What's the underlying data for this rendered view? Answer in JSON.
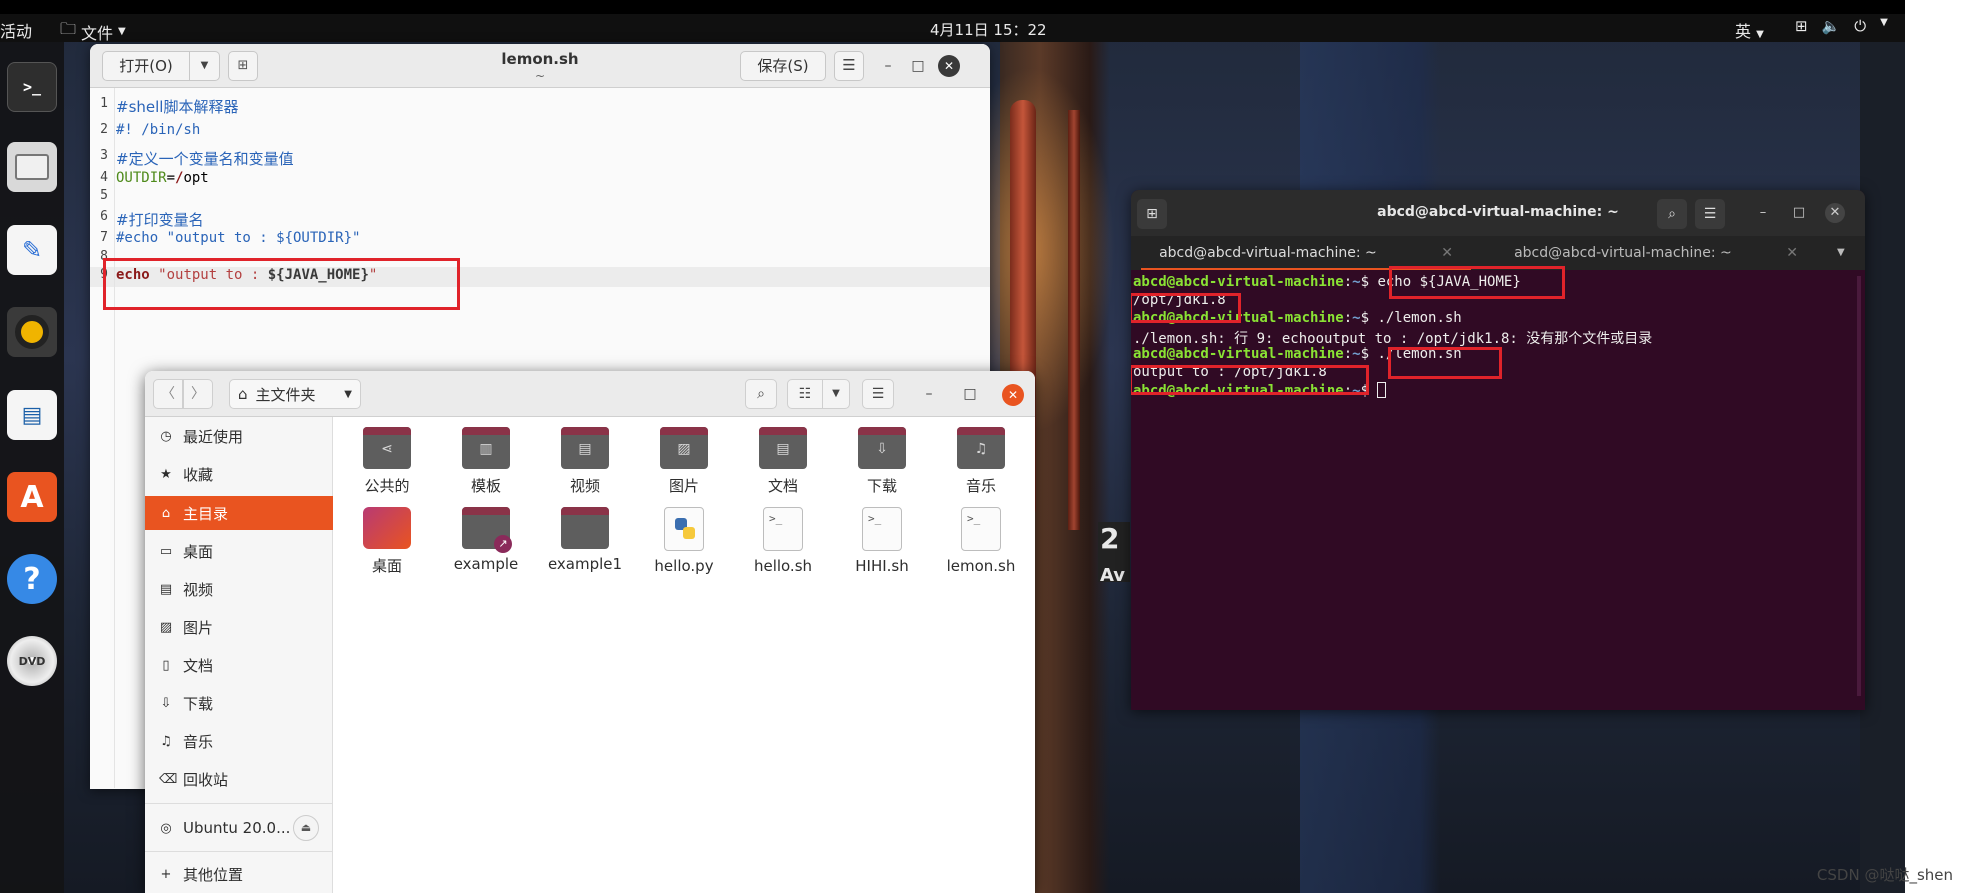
{
  "topbar": {
    "activities": "活动",
    "app_menu": "文件",
    "clock": "4月11日  15：22",
    "lang": "英"
  },
  "dock": {
    "items": [
      {
        "icon": "terminal-icon"
      },
      {
        "icon": "files-icon"
      },
      {
        "icon": "text-editor-icon"
      },
      {
        "icon": "rhythmbox-icon"
      },
      {
        "icon": "libreoffice-writer-icon"
      },
      {
        "icon": "software-center-icon",
        "glyph": "A"
      },
      {
        "icon": "help-icon",
        "glyph": "?"
      },
      {
        "icon": "dvd-icon",
        "glyph": "DVD"
      }
    ]
  },
  "editor": {
    "open_label": "打开(O)",
    "title": "lemon.sh",
    "subtitle": "~",
    "save_label": "保存(S)",
    "lines": [
      {
        "n": "1",
        "text": "#shell脚本解释器"
      },
      {
        "n": "2",
        "text": "#! /bin/sh"
      },
      {
        "n": "3",
        "text": "#定义一个变量名和变量值"
      },
      {
        "n": "4",
        "var": "OUTDIR",
        "op": "=",
        "slash": "/",
        "rest": "opt"
      },
      {
        "n": "5",
        "text": ""
      },
      {
        "n": "6",
        "text": "#打印变量名"
      },
      {
        "n": "7",
        "text": "#echo \"output to : ${OUTDIR}\""
      },
      {
        "n": "8",
        "text": ""
      },
      {
        "n": "9",
        "kw": "echo",
        "str": "\"output to : ",
        "var": "${JAVA_HOME}",
        "end": "\""
      }
    ]
  },
  "terminal": {
    "title": "abcd@abcd-virtual-machine: ~",
    "tabs": [
      "abcd@abcd-virtual-machine: ~",
      "abcd@abcd-virtual-machine: ~"
    ],
    "prompt_user": "abcd@abcd-virtual-machine",
    "prompt_path": "~",
    "lines": [
      {
        "type": "prompt",
        "cmd": "echo ${JAVA_HOME}"
      },
      {
        "type": "out",
        "text": "/opt/jdk1.8"
      },
      {
        "type": "prompt",
        "cmd": "./lemon.sh"
      },
      {
        "type": "out",
        "text": "./lemon.sh: 行 9: echooutput to : /opt/jdk1.8: 没有那个文件或目录"
      },
      {
        "type": "prompt",
        "cmd": "./lemon.sh"
      },
      {
        "type": "out",
        "text": "output to : /opt/jdk1.8"
      },
      {
        "type": "prompt",
        "cmd": ""
      }
    ]
  },
  "files": {
    "path_label": "主文件夹",
    "sidebar": [
      {
        "icon": "recent-icon",
        "label": "最近使用",
        "glyph": "◷"
      },
      {
        "icon": "star-icon",
        "label": "收藏",
        "glyph": "★"
      },
      {
        "icon": "home-icon",
        "label": "主目录",
        "glyph": "⌂",
        "active": true
      },
      {
        "icon": "desktop-icon",
        "label": "桌面",
        "glyph": "▭"
      },
      {
        "icon": "video-icon",
        "label": "视频",
        "glyph": "▤"
      },
      {
        "icon": "picture-icon",
        "label": "图片",
        "glyph": "▨"
      },
      {
        "icon": "document-icon",
        "label": "文档",
        "glyph": "▯"
      },
      {
        "icon": "download-icon",
        "label": "下载",
        "glyph": "⇩"
      },
      {
        "icon": "music-icon",
        "label": "音乐",
        "glyph": "♫"
      },
      {
        "icon": "trash-icon",
        "label": "回收站",
        "glyph": "⌫"
      }
    ],
    "device": {
      "icon": "disc-icon",
      "label": "Ubuntu 20.0...",
      "glyph": "◎"
    },
    "other": {
      "icon": "plus-icon",
      "label": "其他位置",
      "glyph": "+"
    },
    "items_row1": [
      {
        "label": "公共的",
        "emblem": "⋖"
      },
      {
        "label": "模板",
        "emblem": "▥"
      },
      {
        "label": "视频",
        "emblem": "▤"
      },
      {
        "label": "图片",
        "emblem": "▨"
      },
      {
        "label": "文档",
        "emblem": "▤"
      },
      {
        "label": "下载",
        "emblem": "⇩"
      },
      {
        "label": "音乐",
        "emblem": "♫"
      }
    ],
    "items_row2": [
      {
        "label": "桌面",
        "kind": "desktop"
      },
      {
        "label": "example",
        "kind": "link"
      },
      {
        "label": "example1",
        "kind": "folder"
      },
      {
        "label": "hello.py",
        "kind": "python"
      },
      {
        "label": "hello.sh",
        "kind": "script"
      },
      {
        "label": "HIHI.sh",
        "kind": "script"
      },
      {
        "label": "lemon.sh",
        "kind": "script"
      }
    ]
  },
  "watermark": "CSDN @哒哒_shen"
}
